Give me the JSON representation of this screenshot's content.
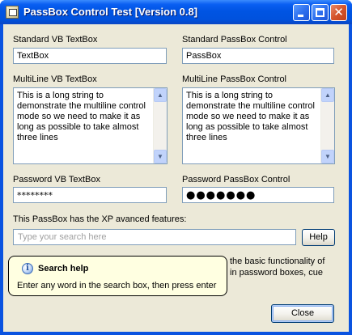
{
  "window": {
    "title": "PassBox Control Test [Version 0.8]",
    "app_icon": "window-icon",
    "controls": {
      "minimize_icon": "minimize-icon",
      "maximize_icon": "maximize-icon",
      "close_icon": "close-icon",
      "close_glyph": "✕"
    },
    "colors": {
      "titlebar": "#0054e3",
      "client_bg": "#ece9d8",
      "balloon_bg": "#ffffe1"
    }
  },
  "standard": {
    "vb_label": "Standard VB TextBox",
    "vb_value": "TextBox",
    "passbox_label": "Standard PassBox Control",
    "passbox_value": "PassBox"
  },
  "multiline": {
    "vb_label": "MultiLine VB TextBox",
    "vb_value": "This is a long string to\ndemonstrate the multiline control\nmode so we need to make it as\nlong as possible to take almost\nthree lines",
    "passbox_label": "MultiLine PassBox Control",
    "passbox_value": "This is a long string to\ndemonstrate the multiline control\nmode so we need to make it as\nlong as possible to take almost\nthree lines",
    "scroll_up_glyph": "▲",
    "scroll_down_glyph": "▼"
  },
  "password": {
    "vb_label": "Password VB TextBox",
    "vb_value": "********",
    "passbox_label": "Password PassBox Control",
    "passbox_value": "●●●●●●●"
  },
  "xp_section": {
    "label": "This PassBox has the XP avanced features:",
    "search_placeholder": "Type your search here",
    "help_button": "Help",
    "description_line1": "the basic functionality of",
    "description_line2": "in password boxes, cue"
  },
  "balloon": {
    "icon": "info-icon",
    "icon_glyph": "i",
    "title": "Search help",
    "text": "Enter any word in the search box, then press enter"
  },
  "footer": {
    "close_button": "Close"
  }
}
